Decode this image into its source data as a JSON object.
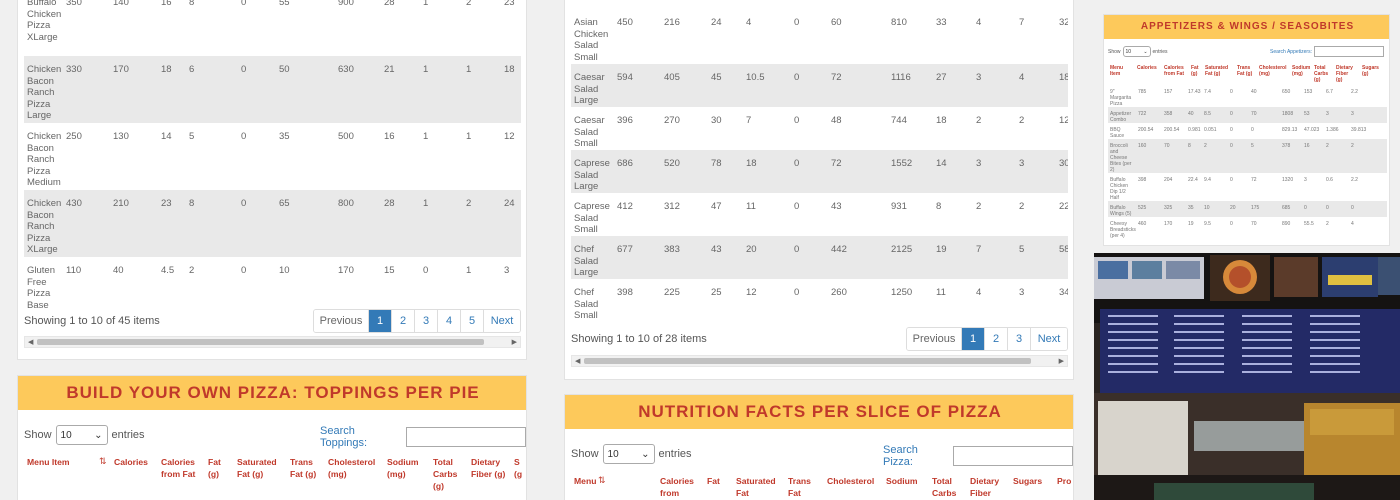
{
  "left_top": {
    "columns": [
      "name",
      "calories",
      "calories_from_fat",
      "fat",
      "saturated_fat",
      "trans_fat",
      "cholesterol",
      "sodium",
      "total_carbs",
      "dietary_fiber",
      "sugars"
    ],
    "rows": [
      {
        "name": "Buffalo Chicken Pizza XLarge",
        "values": [
          "350",
          "140",
          "16",
          "8",
          "0",
          "55",
          "900",
          "28",
          "1",
          "2",
          "23"
        ]
      },
      {
        "name": "Chicken Bacon Ranch Pizza Large",
        "values": [
          "330",
          "170",
          "18",
          "6",
          "0",
          "50",
          "630",
          "21",
          "1",
          "1",
          "18"
        ]
      },
      {
        "name": "Chicken Bacon Ranch Pizza Medium",
        "values": [
          "250",
          "130",
          "14",
          "5",
          "0",
          "35",
          "500",
          "16",
          "1",
          "1",
          "12"
        ]
      },
      {
        "name": "Chicken Bacon Ranch Pizza XLarge",
        "values": [
          "430",
          "210",
          "23",
          "8",
          "0",
          "65",
          "800",
          "28",
          "1",
          "2",
          "24"
        ]
      },
      {
        "name": "Gluten Free Pizza Base",
        "values": [
          "110",
          "40",
          "4.5",
          "2",
          "0",
          "10",
          "170",
          "15",
          "0",
          "1",
          "3"
        ]
      }
    ],
    "info": "Showing 1 to 10 of 45 items",
    "pager": [
      "Previous",
      "1",
      "2",
      "3",
      "4",
      "5",
      "Next"
    ],
    "active_page": "1"
  },
  "middle_top": {
    "rows": [
      {
        "name": "Asian Chicken Salad Small",
        "values": [
          "450",
          "216",
          "24",
          "4",
          "0",
          "60",
          "810",
          "33",
          "4",
          "7",
          "32"
        ]
      },
      {
        "name": "Caesar Salad Large",
        "values": [
          "594",
          "405",
          "45",
          "10.5",
          "0",
          "72",
          "1116",
          "27",
          "3",
          "4",
          "18"
        ]
      },
      {
        "name": "Caesar Salad Small",
        "values": [
          "396",
          "270",
          "30",
          "7",
          "0",
          "48",
          "744",
          "18",
          "2",
          "2",
          "12"
        ]
      },
      {
        "name": "Caprese Salad Large",
        "values": [
          "686",
          "520",
          "78",
          "18",
          "0",
          "72",
          "1552",
          "14",
          "3",
          "3",
          "30"
        ]
      },
      {
        "name": "Caprese Salad Small",
        "values": [
          "412",
          "312",
          "47",
          "11",
          "0",
          "43",
          "931",
          "8",
          "2",
          "2",
          "22"
        ]
      },
      {
        "name": "Chef Salad Large",
        "values": [
          "677",
          "383",
          "43",
          "20",
          "0",
          "442",
          "2125",
          "19",
          "7",
          "5",
          "58"
        ]
      },
      {
        "name": "Chef Salad Small",
        "values": [
          "398",
          "225",
          "25",
          "12",
          "0",
          "260",
          "1250",
          "11",
          "4",
          "3",
          "34"
        ]
      }
    ],
    "info": "Showing 1 to 10 of 28 items",
    "pager": [
      "Previous",
      "1",
      "2",
      "3",
      "Next"
    ],
    "active_page": "1"
  },
  "toppings": {
    "title": "BUILD YOUR OWN PIZZA: TOPPINGS PER PIE",
    "show_label": "Show",
    "entries_value": "10",
    "entries_label": "entries",
    "search_label": "Search Toppings:",
    "headers": [
      "Menu Item",
      "Calories",
      "Calories from Fat",
      "Fat (g)",
      "Saturated Fat (g)",
      "Trans Fat (g)",
      "Cholesterol (mg)",
      "Sodium (mg)",
      "Total Carbs (g)",
      "Dietary Fiber (g)",
      "S (g"
    ]
  },
  "pizza_slice": {
    "title": "NUTRITION FACTS PER SLICE OF PIZZA",
    "show_label": "Show",
    "entries_value": "10",
    "entries_label": "entries",
    "search_label": "Search Pizza:",
    "headers": [
      "Menu",
      "Calories from",
      "Fat",
      "Saturated Fat",
      "Trans Fat",
      "Cholesterol",
      "Sodium",
      "Total Carbs",
      "Dietary Fiber",
      "Sugars",
      "Pro"
    ]
  },
  "appetizers": {
    "title": "APPETIZERS & WINGS / SEASOBITES",
    "show_label": "Show",
    "entries_value": "10",
    "entries_label": "entries",
    "search_label": "Search Appetizers:",
    "headers": [
      "Menu Item",
      "Calories",
      "Calories from Fat",
      "Fat (g)",
      "Saturated Fat (g)",
      "Trans Fat (g)",
      "Cholesterol (mg)",
      "Sodium (mg)",
      "Total Carbs (g)",
      "Dietary Fiber (g)",
      "Sugars (g)"
    ],
    "rows": [
      {
        "name": "9\" Margarita Pizza",
        "values": [
          "785",
          "157",
          "17.43",
          "7.4",
          "0",
          "40",
          "650",
          "153",
          "6.7",
          "2.2"
        ]
      },
      {
        "name": "Appetizer Combo",
        "values": [
          "722",
          "358",
          "40",
          "8.5",
          "0",
          "70",
          "1808",
          "53",
          "3",
          "3"
        ]
      },
      {
        "name": "BBQ Sauce",
        "values": [
          "200.54",
          "200.54",
          "0.981",
          "0.051",
          "0",
          "0",
          "829.13",
          "47.023",
          "1.386",
          "39.813"
        ]
      },
      {
        "name": "Broccoli and Cheese Bites (per 2)",
        "values": [
          "160",
          "70",
          "8",
          "2",
          "0",
          "5",
          "378",
          "16",
          "2",
          "2"
        ]
      },
      {
        "name": "Buffalo Chicken Dip 1/2 Half",
        "values": [
          "398",
          "204",
          "22.4",
          "9.4",
          "0",
          "72",
          "1320",
          "3",
          "0.6",
          "2.2"
        ]
      },
      {
        "name": "Buffalo Wings (5)",
        "values": [
          "525",
          "325",
          "35",
          "10",
          "20",
          "175",
          "685",
          "0",
          "0",
          "0"
        ]
      },
      {
        "name": "Cheesy Breadsticks (per 4)",
        "values": [
          "460",
          "170",
          "19",
          "9.5",
          "0",
          "70",
          "890",
          "55.5",
          "2",
          "4"
        ]
      }
    ]
  }
}
